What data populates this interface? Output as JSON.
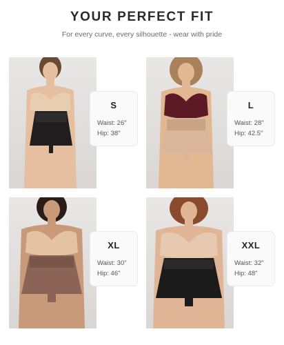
{
  "header": {
    "title": "YOUR PERFECT FIT",
    "subtitle": "For every curve, every silhouette - wear with pride"
  },
  "sizes": [
    {
      "size": "S",
      "waist": "Waist: 26\"",
      "hip": "Hip: 38\"",
      "garment_color": "#1f1d1e",
      "top_color": "#e8cdb1"
    },
    {
      "size": "L",
      "waist": "Waist: 28\"",
      "hip": "Hip: 42.5\"",
      "garment_color": "#d9b59a",
      "top_color": "#5b1a24"
    },
    {
      "size": "XL",
      "waist": "Waist: 30\"",
      "hip": "Hip: 46\"",
      "garment_color": "#8b6357",
      "top_color": "#e3c3a3"
    },
    {
      "size": "XXL",
      "waist": "Waist: 32\"",
      "hip": "Hip: 48\"",
      "garment_color": "#1c1b1c",
      "top_color": "#e6c9ae"
    }
  ]
}
